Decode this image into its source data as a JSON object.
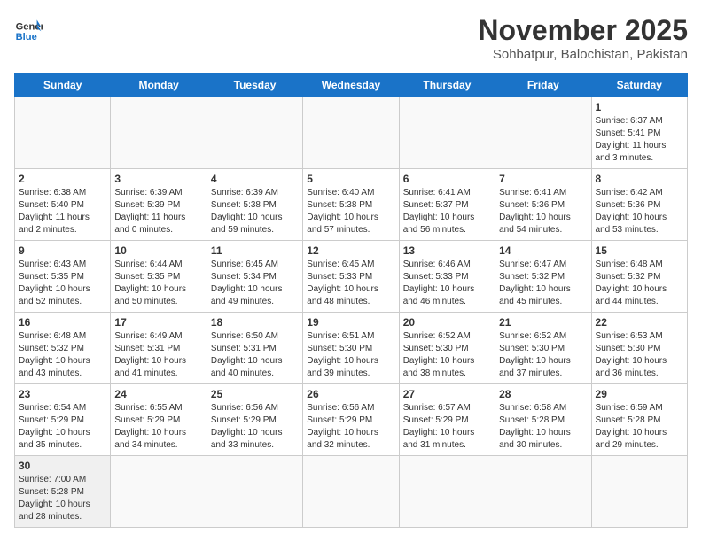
{
  "header": {
    "logo_general": "General",
    "logo_blue": "Blue",
    "month": "November 2025",
    "location": "Sohbatpur, Balochistan, Pakistan"
  },
  "days_of_week": [
    "Sunday",
    "Monday",
    "Tuesday",
    "Wednesday",
    "Thursday",
    "Friday",
    "Saturday"
  ],
  "weeks": [
    [
      {
        "day": "",
        "info": ""
      },
      {
        "day": "",
        "info": ""
      },
      {
        "day": "",
        "info": ""
      },
      {
        "day": "",
        "info": ""
      },
      {
        "day": "",
        "info": ""
      },
      {
        "day": "",
        "info": ""
      },
      {
        "day": "1",
        "info": "Sunrise: 6:37 AM\nSunset: 5:41 PM\nDaylight: 11 hours\nand 3 minutes."
      }
    ],
    [
      {
        "day": "2",
        "info": "Sunrise: 6:38 AM\nSunset: 5:40 PM\nDaylight: 11 hours\nand 2 minutes."
      },
      {
        "day": "3",
        "info": "Sunrise: 6:39 AM\nSunset: 5:39 PM\nDaylight: 11 hours\nand 0 minutes."
      },
      {
        "day": "4",
        "info": "Sunrise: 6:39 AM\nSunset: 5:38 PM\nDaylight: 10 hours\nand 59 minutes."
      },
      {
        "day": "5",
        "info": "Sunrise: 6:40 AM\nSunset: 5:38 PM\nDaylight: 10 hours\nand 57 minutes."
      },
      {
        "day": "6",
        "info": "Sunrise: 6:41 AM\nSunset: 5:37 PM\nDaylight: 10 hours\nand 56 minutes."
      },
      {
        "day": "7",
        "info": "Sunrise: 6:41 AM\nSunset: 5:36 PM\nDaylight: 10 hours\nand 54 minutes."
      },
      {
        "day": "8",
        "info": "Sunrise: 6:42 AM\nSunset: 5:36 PM\nDaylight: 10 hours\nand 53 minutes."
      }
    ],
    [
      {
        "day": "9",
        "info": "Sunrise: 6:43 AM\nSunset: 5:35 PM\nDaylight: 10 hours\nand 52 minutes."
      },
      {
        "day": "10",
        "info": "Sunrise: 6:44 AM\nSunset: 5:35 PM\nDaylight: 10 hours\nand 50 minutes."
      },
      {
        "day": "11",
        "info": "Sunrise: 6:45 AM\nSunset: 5:34 PM\nDaylight: 10 hours\nand 49 minutes."
      },
      {
        "day": "12",
        "info": "Sunrise: 6:45 AM\nSunset: 5:33 PM\nDaylight: 10 hours\nand 48 minutes."
      },
      {
        "day": "13",
        "info": "Sunrise: 6:46 AM\nSunset: 5:33 PM\nDaylight: 10 hours\nand 46 minutes."
      },
      {
        "day": "14",
        "info": "Sunrise: 6:47 AM\nSunset: 5:32 PM\nDaylight: 10 hours\nand 45 minutes."
      },
      {
        "day": "15",
        "info": "Sunrise: 6:48 AM\nSunset: 5:32 PM\nDaylight: 10 hours\nand 44 minutes."
      }
    ],
    [
      {
        "day": "16",
        "info": "Sunrise: 6:48 AM\nSunset: 5:32 PM\nDaylight: 10 hours\nand 43 minutes."
      },
      {
        "day": "17",
        "info": "Sunrise: 6:49 AM\nSunset: 5:31 PM\nDaylight: 10 hours\nand 41 minutes."
      },
      {
        "day": "18",
        "info": "Sunrise: 6:50 AM\nSunset: 5:31 PM\nDaylight: 10 hours\nand 40 minutes."
      },
      {
        "day": "19",
        "info": "Sunrise: 6:51 AM\nSunset: 5:30 PM\nDaylight: 10 hours\nand 39 minutes."
      },
      {
        "day": "20",
        "info": "Sunrise: 6:52 AM\nSunset: 5:30 PM\nDaylight: 10 hours\nand 38 minutes."
      },
      {
        "day": "21",
        "info": "Sunrise: 6:52 AM\nSunset: 5:30 PM\nDaylight: 10 hours\nand 37 minutes."
      },
      {
        "day": "22",
        "info": "Sunrise: 6:53 AM\nSunset: 5:30 PM\nDaylight: 10 hours\nand 36 minutes."
      }
    ],
    [
      {
        "day": "23",
        "info": "Sunrise: 6:54 AM\nSunset: 5:29 PM\nDaylight: 10 hours\nand 35 minutes."
      },
      {
        "day": "24",
        "info": "Sunrise: 6:55 AM\nSunset: 5:29 PM\nDaylight: 10 hours\nand 34 minutes."
      },
      {
        "day": "25",
        "info": "Sunrise: 6:56 AM\nSunset: 5:29 PM\nDaylight: 10 hours\nand 33 minutes."
      },
      {
        "day": "26",
        "info": "Sunrise: 6:56 AM\nSunset: 5:29 PM\nDaylight: 10 hours\nand 32 minutes."
      },
      {
        "day": "27",
        "info": "Sunrise: 6:57 AM\nSunset: 5:29 PM\nDaylight: 10 hours\nand 31 minutes."
      },
      {
        "day": "28",
        "info": "Sunrise: 6:58 AM\nSunset: 5:28 PM\nDaylight: 10 hours\nand 30 minutes."
      },
      {
        "day": "29",
        "info": "Sunrise: 6:59 AM\nSunset: 5:28 PM\nDaylight: 10 hours\nand 29 minutes."
      }
    ],
    [
      {
        "day": "30",
        "info": "Sunrise: 7:00 AM\nSunset: 5:28 PM\nDaylight: 10 hours\nand 28 minutes."
      },
      {
        "day": "",
        "info": ""
      },
      {
        "day": "",
        "info": ""
      },
      {
        "day": "",
        "info": ""
      },
      {
        "day": "",
        "info": ""
      },
      {
        "day": "",
        "info": ""
      },
      {
        "day": "",
        "info": ""
      }
    ]
  ]
}
